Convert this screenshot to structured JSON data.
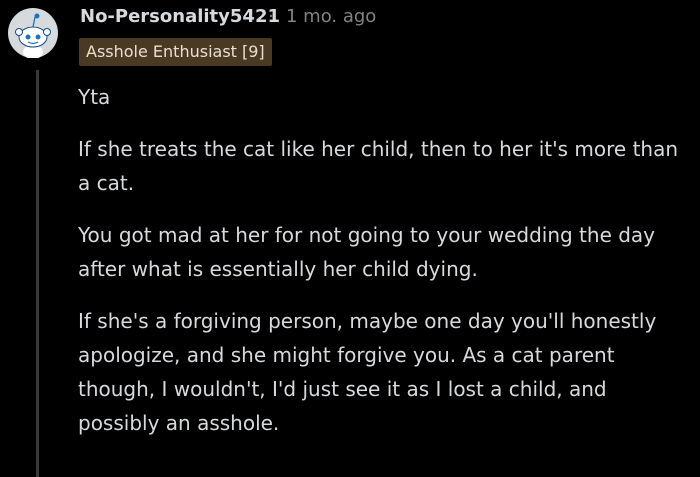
{
  "comment": {
    "username": "No-Personality5421",
    "separator": "·",
    "timestamp": "1 mo. ago",
    "flair": "Asshole Enthusiast [9]",
    "paragraphs": [
      "Yta",
      "If she treats the cat like her child, then to her it's more than a cat.",
      "You got mad at her for not going to your wedding the day after what is essentially her child dying.",
      "If she's a forgiving person, maybe one day you'll honestly apologize, and she might forgive you. As a cat parent though, I wouldn't, I'd just see it as I lost a child, and possibly an asshole."
    ]
  },
  "colors": {
    "background": "#000000",
    "text": "#d7dadc",
    "meta": "#818384",
    "flair_bg": "#4b3a23",
    "avatar_bg": "#d7dadc",
    "snoo_blue": "#1e73be"
  },
  "icons": {
    "avatar": "reddit-snoo-avatar-icon"
  }
}
